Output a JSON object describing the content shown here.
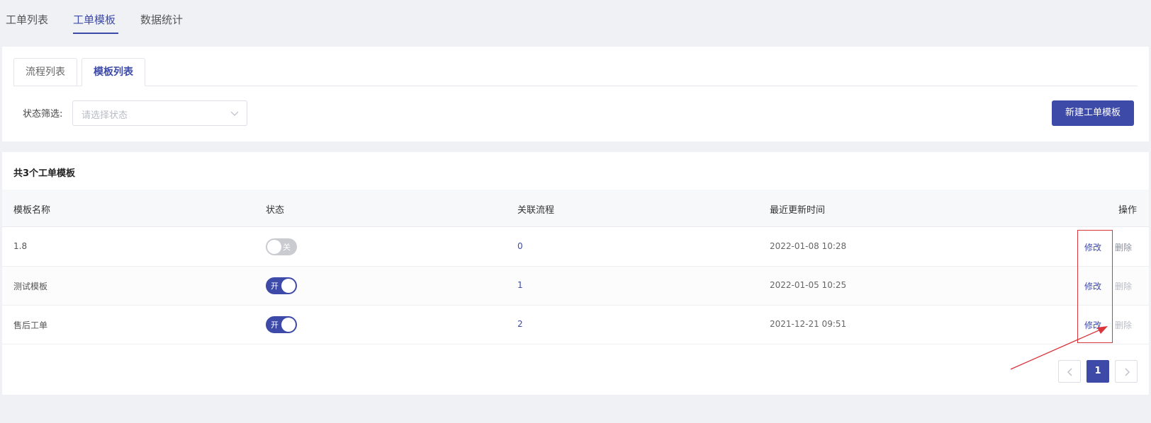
{
  "top_tabs": [
    {
      "label": "工单列表"
    },
    {
      "label": "工单模板",
      "active": true
    },
    {
      "label": "数据统计"
    }
  ],
  "sub_tabs": [
    {
      "label": "流程列表"
    },
    {
      "label": "模板列表",
      "active": true
    }
  ],
  "filter": {
    "label": "状态筛选:",
    "placeholder": "请选择状态"
  },
  "new_button": "新建工单模板",
  "list": {
    "count_title": "共3个工单模板",
    "headers": {
      "name": "模板名称",
      "status": "状态",
      "flow": "关联流程",
      "updated": "最近更新时间",
      "ops": "操作"
    },
    "rows": [
      {
        "name": "1.8",
        "status": "关",
        "enabled": false,
        "flow": "0",
        "updated": "2022-01-08 10:28",
        "edit": "修改",
        "delete": "删除"
      },
      {
        "name": "测试模板",
        "status": "开",
        "enabled": true,
        "flow": "1",
        "updated": "2022-01-05 10:25",
        "edit": "修改",
        "delete": "删除"
      },
      {
        "name": "售后工单",
        "status": "开",
        "enabled": true,
        "flow": "2",
        "updated": "2021-12-21 09:51",
        "edit": "修改",
        "delete": "删除"
      }
    ]
  },
  "pagination": {
    "current_page": "1"
  },
  "colors": {
    "accent": "#3d4aa8",
    "annotation": "#d9363e",
    "page_bg": "#f0f1f5"
  }
}
